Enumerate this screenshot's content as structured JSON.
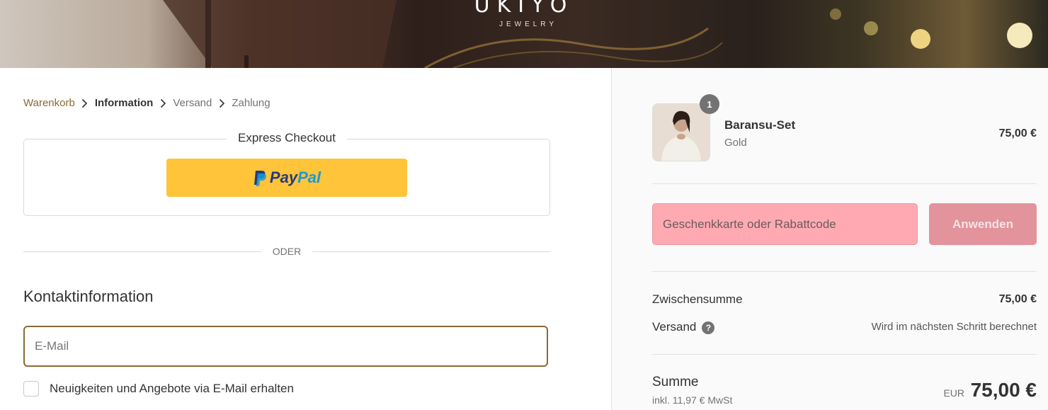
{
  "brand": {
    "word": "UKIYO",
    "sub": "JEWELRY"
  },
  "breadcrumb": {
    "cart": "Warenkorb",
    "information": "Information",
    "shipping": "Versand",
    "payment": "Zahlung",
    "separator": "chevron-right-icon"
  },
  "express": {
    "title": "Express Checkout",
    "paypal_a": "Pay",
    "paypal_b": "Pal"
  },
  "divider": "ODER",
  "contact": {
    "title": "Kontaktinformation",
    "email_placeholder": "E-Mail",
    "newsletter_label": "Neuigkeiten und Angebote via E-Mail erhalten"
  },
  "summary": {
    "item": {
      "quantity": "1",
      "name": "Baransu-Set",
      "variant": "Gold",
      "price": "75,00 €"
    },
    "discount": {
      "placeholder": "Geschenkkarte oder Rabattcode",
      "apply": "Anwenden"
    },
    "subtotal_label": "Zwischensumme",
    "subtotal_value": "75,00 €",
    "shipping_label": "Versand",
    "shipping_value": "Wird im nächsten Schritt berechnet",
    "help": "?",
    "total_label": "Summe",
    "tax_note": "inkl. 11,97 € MwSt",
    "currency": "EUR",
    "total_value": "75,00 €"
  },
  "colors": {
    "accent": "#8b6a35",
    "paypal_yellow": "#ffc439",
    "discount_bg": "#ffaab3",
    "apply_bg": "#e3939c"
  }
}
